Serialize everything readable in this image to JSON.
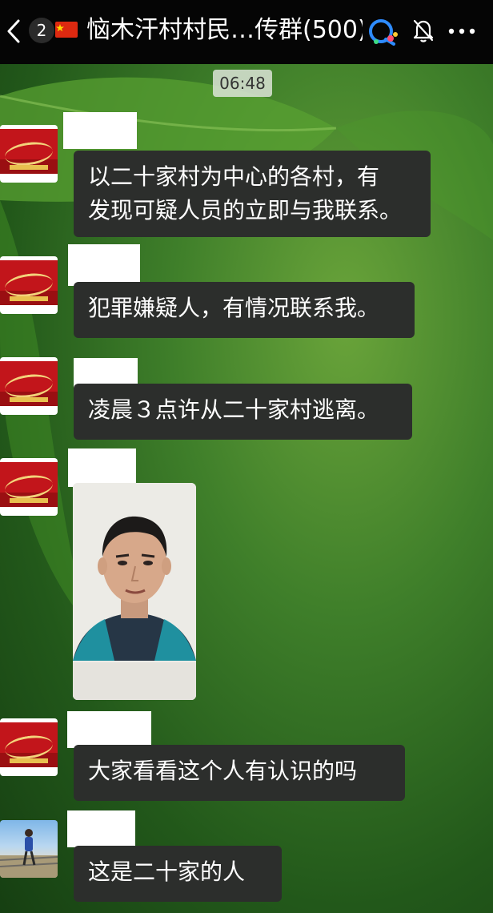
{
  "header": {
    "unread_count": "2",
    "title": "恼木汗村村民…传群(500)",
    "icons": [
      "back-icon",
      "flag-icon",
      "qq-icon",
      "bell-mute-icon",
      "more-icon"
    ]
  },
  "timestamp": "06:48",
  "messages": [
    {
      "type": "text",
      "lines": [
        "以二十家村为中心的各村，有",
        "发现可疑人员的立即与我联系。"
      ]
    },
    {
      "type": "text",
      "lines": [
        "犯罪嫌疑人，有情况联系我。"
      ]
    },
    {
      "type": "text",
      "lines": [
        "凌晨３点许从二十家村逃离。"
      ]
    },
    {
      "type": "image",
      "description": "portrait photo"
    },
    {
      "type": "text",
      "lines": [
        "大家看看这个人有认识的吗"
      ]
    },
    {
      "type": "text",
      "lines": [
        "这是二十家的人"
      ]
    }
  ],
  "colors": {
    "header_bg": "#050505",
    "bubble_bg": "#2c2e2c",
    "bubble_text": "#ffffff",
    "avatar_red": "#c2151b"
  }
}
